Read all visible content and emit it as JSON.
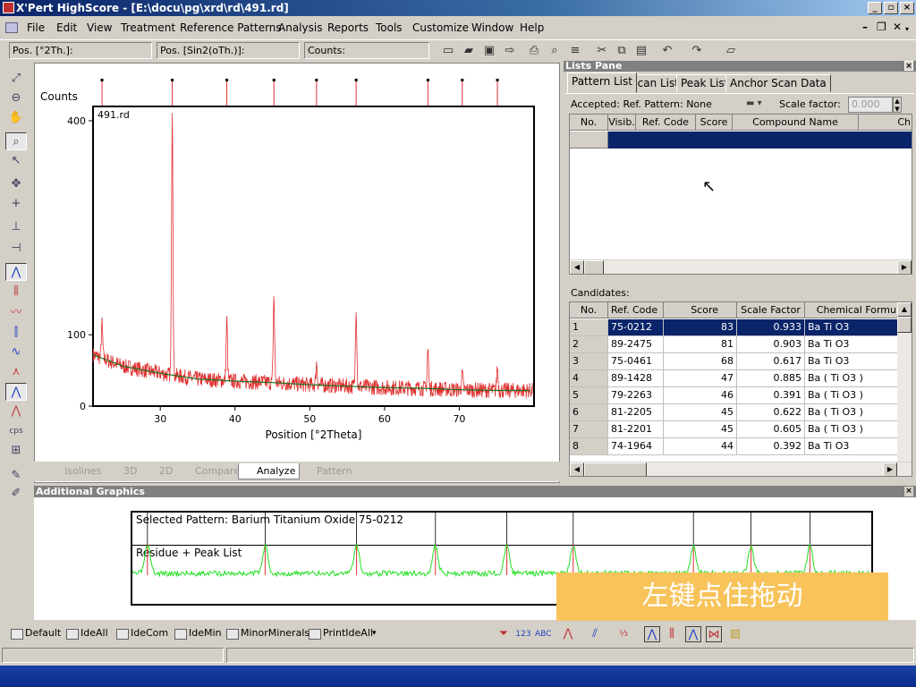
{
  "window": {
    "title": "X'Pert HighScore - [E:\\docu\\pg\\xrd\\rd\\491.rd]"
  },
  "menu": [
    "File",
    "Edit",
    "View",
    "Treatment",
    "Reference Patterns",
    "Analysis",
    "Reports",
    "Tools",
    "Customize",
    "Window",
    "Help"
  ],
  "position_fields": {
    "pos1": "Pos. [°2Th.]:",
    "pos2": "Pos. [Sin2(oTh.)]:",
    "counts": "Counts:"
  },
  "view_tabs": [
    "Isolines",
    "3D",
    "2D",
    "Compare",
    "Analyze",
    "Pattern"
  ],
  "lists_pane": {
    "title": "Lists Pane",
    "tabs": [
      "Pattern List",
      "Scan List",
      "Peak List",
      "Anchor Scan Data"
    ],
    "accepted": "Accepted: Ref. Pattern: None",
    "scale_factor_label": "Scale factor:",
    "scale_factor_value": "0.000",
    "pattern_headers": [
      "No.",
      "Visib.",
      "Ref. Code",
      "Score",
      "Compound Name",
      "Ch"
    ],
    "candidates_label": "Candidates:",
    "candidate_headers": [
      "No.",
      "Ref. Code",
      "Score",
      "Scale Factor",
      "Chemical Formu"
    ],
    "candidates": [
      {
        "no": "1",
        "code": "75-0212",
        "score": "83",
        "scale": "0.933",
        "formula": "Ba Ti O3"
      },
      {
        "no": "2",
        "code": "89-2475",
        "score": "81",
        "scale": "0.903",
        "formula": "Ba Ti O3"
      },
      {
        "no": "3",
        "code": "75-0461",
        "score": "68",
        "scale": "0.617",
        "formula": "Ba Ti O3"
      },
      {
        "no": "4",
        "code": "89-1428",
        "score": "47",
        "scale": "0.885",
        "formula": "Ba ( Ti O3 )"
      },
      {
        "no": "5",
        "code": "79-2263",
        "score": "46",
        "scale": "0.391",
        "formula": "Ba ( Ti O3 )"
      },
      {
        "no": "6",
        "code": "81-2205",
        "score": "45",
        "scale": "0.622",
        "formula": "Ba ( Ti O3 )"
      },
      {
        "no": "7",
        "code": "81-2201",
        "score": "45",
        "scale": "0.605",
        "formula": "Ba ( Ti O3 )"
      },
      {
        "no": "8",
        "code": "74-1964",
        "score": "44",
        "scale": "0.392",
        "formula": "Ba Ti O3"
      }
    ]
  },
  "additional_graphics": {
    "title": "Additional Graphics",
    "selected_pattern": "Selected Pattern: Barium Titanium Oxide  75-0212",
    "residue": "Residue + Peak List"
  },
  "bottom_toolbar": [
    "Default",
    "IdeAll",
    "IdeCom",
    "IdeMin",
    "MinorMinerals",
    "PrintIdeAll"
  ],
  "overlay_text": "左键点住拖动",
  "colors": {
    "pattern": "#e03030",
    "background_fit": "#207020",
    "residue": "#20e020",
    "selection": "#0a246a"
  },
  "chart_data": {
    "type": "line",
    "title": "491.rd",
    "xlabel": "Position [°2Theta]",
    "ylabel": "Counts",
    "xlim": [
      21,
      80
    ],
    "ylim": [
      0,
      420
    ],
    "xticks": [
      30,
      40,
      50,
      60,
      70
    ],
    "yticks": [
      0,
      100,
      400
    ],
    "peaks": [
      {
        "x": 22.2,
        "y": 115
      },
      {
        "x": 31.6,
        "y": 420
      },
      {
        "x": 38.9,
        "y": 120
      },
      {
        "x": 45.2,
        "y": 155
      },
      {
        "x": 50.9,
        "y": 60
      },
      {
        "x": 56.2,
        "y": 140
      },
      {
        "x": 65.8,
        "y": 80
      },
      {
        "x": 70.4,
        "y": 45
      },
      {
        "x": 75.1,
        "y": 55
      }
    ],
    "background": [
      [
        21,
        72
      ],
      [
        25,
        56
      ],
      [
        30,
        46
      ],
      [
        35,
        38
      ],
      [
        40,
        35
      ],
      [
        45,
        33
      ],
      [
        50,
        30
      ],
      [
        55,
        28
      ],
      [
        60,
        26
      ],
      [
        65,
        25
      ],
      [
        70,
        23
      ],
      [
        75,
        22
      ],
      [
        79,
        22
      ]
    ],
    "ref_lines_x": [
      22.2,
      31.6,
      38.9,
      45.2,
      50.9,
      56.2,
      65.8,
      70.4,
      75.1
    ]
  }
}
